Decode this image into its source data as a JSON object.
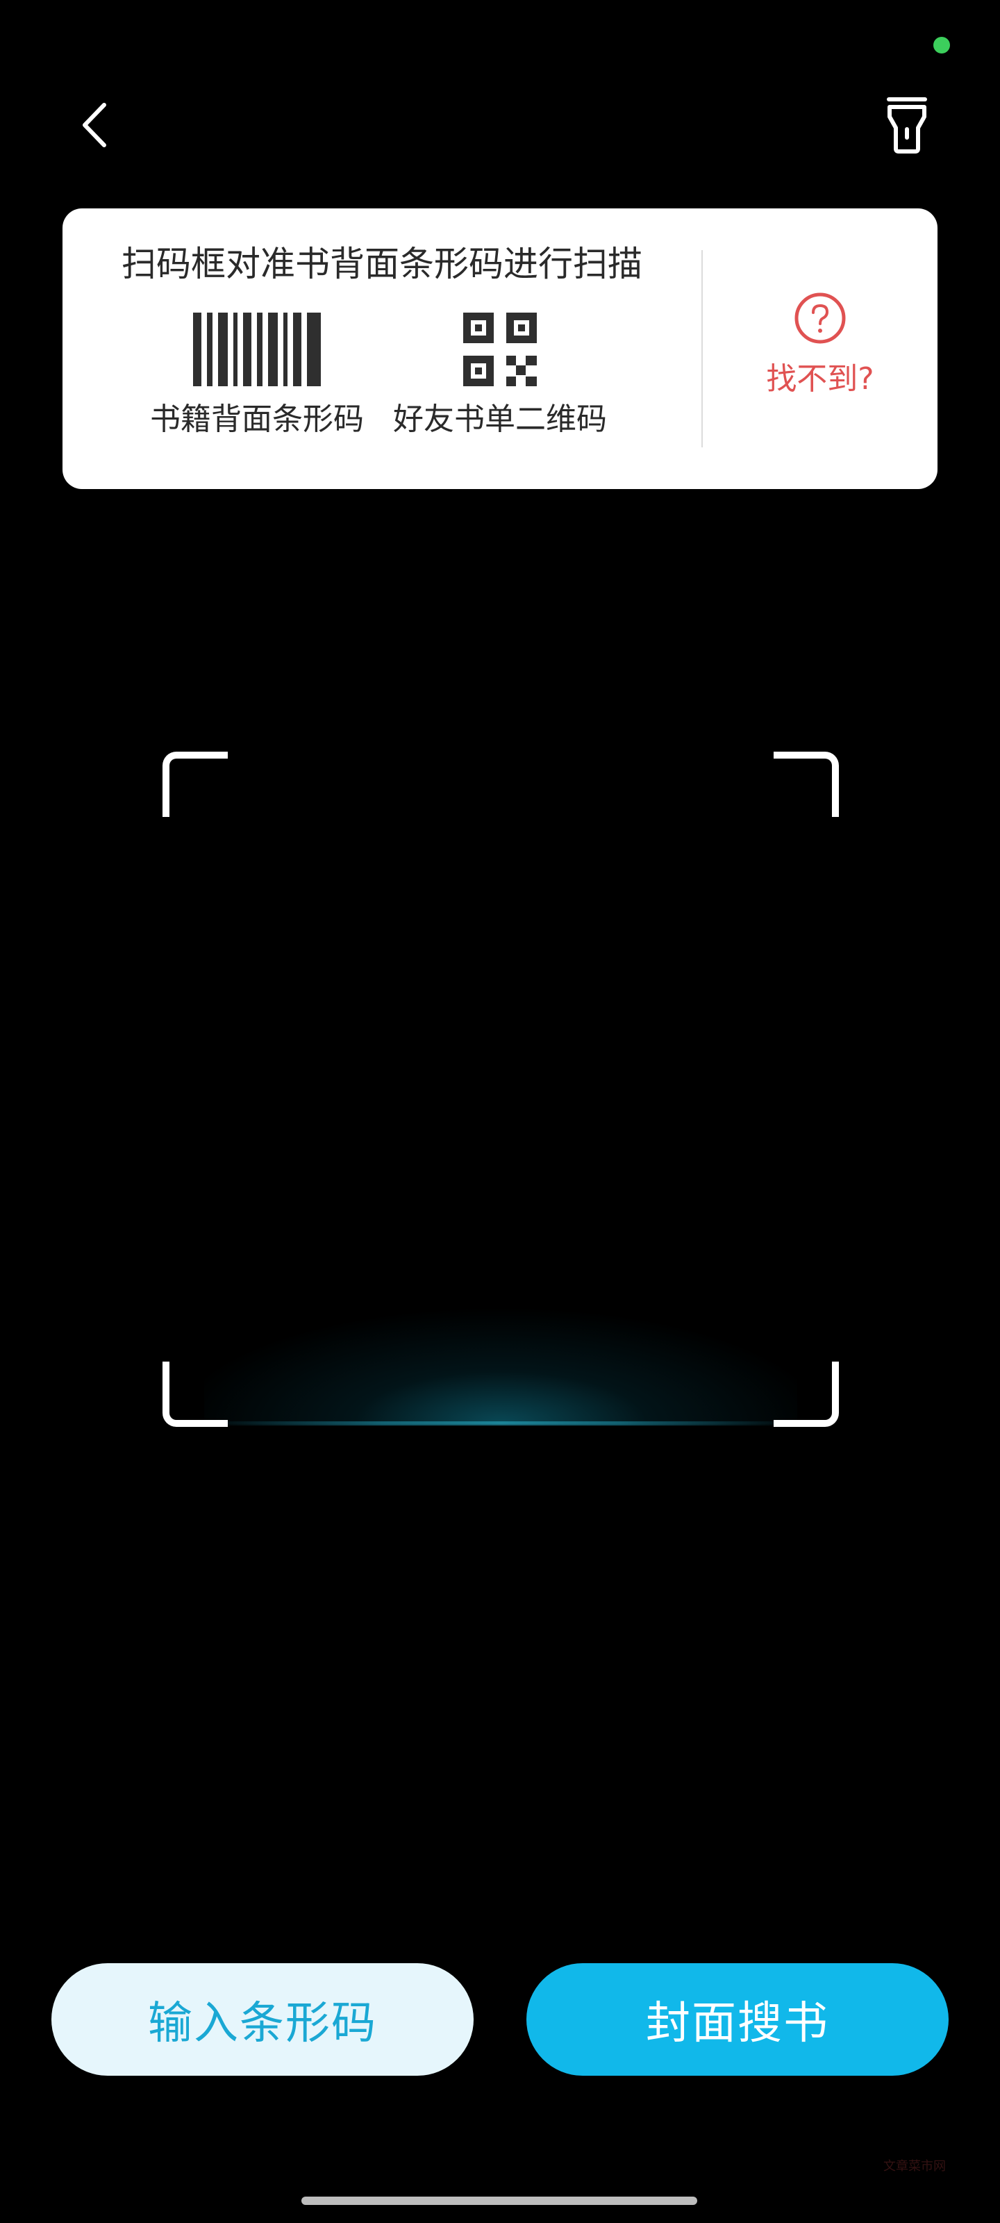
{
  "status_bar": {
    "indicator_color": "#3ccf5c"
  },
  "toolbar": {
    "back_icon": "chevron-left-icon",
    "flashlight_icon": "flashlight-icon"
  },
  "hint_card": {
    "title": "扫码框对准书背面条形码进行扫描",
    "options": [
      {
        "icon": "barcode-icon",
        "label": "书籍背面条形码"
      },
      {
        "icon": "qr-code-icon",
        "label": "好友书单二维码"
      }
    ],
    "help": {
      "icon": "question-circle-icon",
      "label": "找不到?",
      "color": "#e05252"
    }
  },
  "buttons": {
    "input_barcode": "输入条形码",
    "cover_search": "封面搜书"
  },
  "colors": {
    "accent": "#11b8ea",
    "accent_light": "#e6f6fc"
  },
  "watermark": "文章菜市网"
}
